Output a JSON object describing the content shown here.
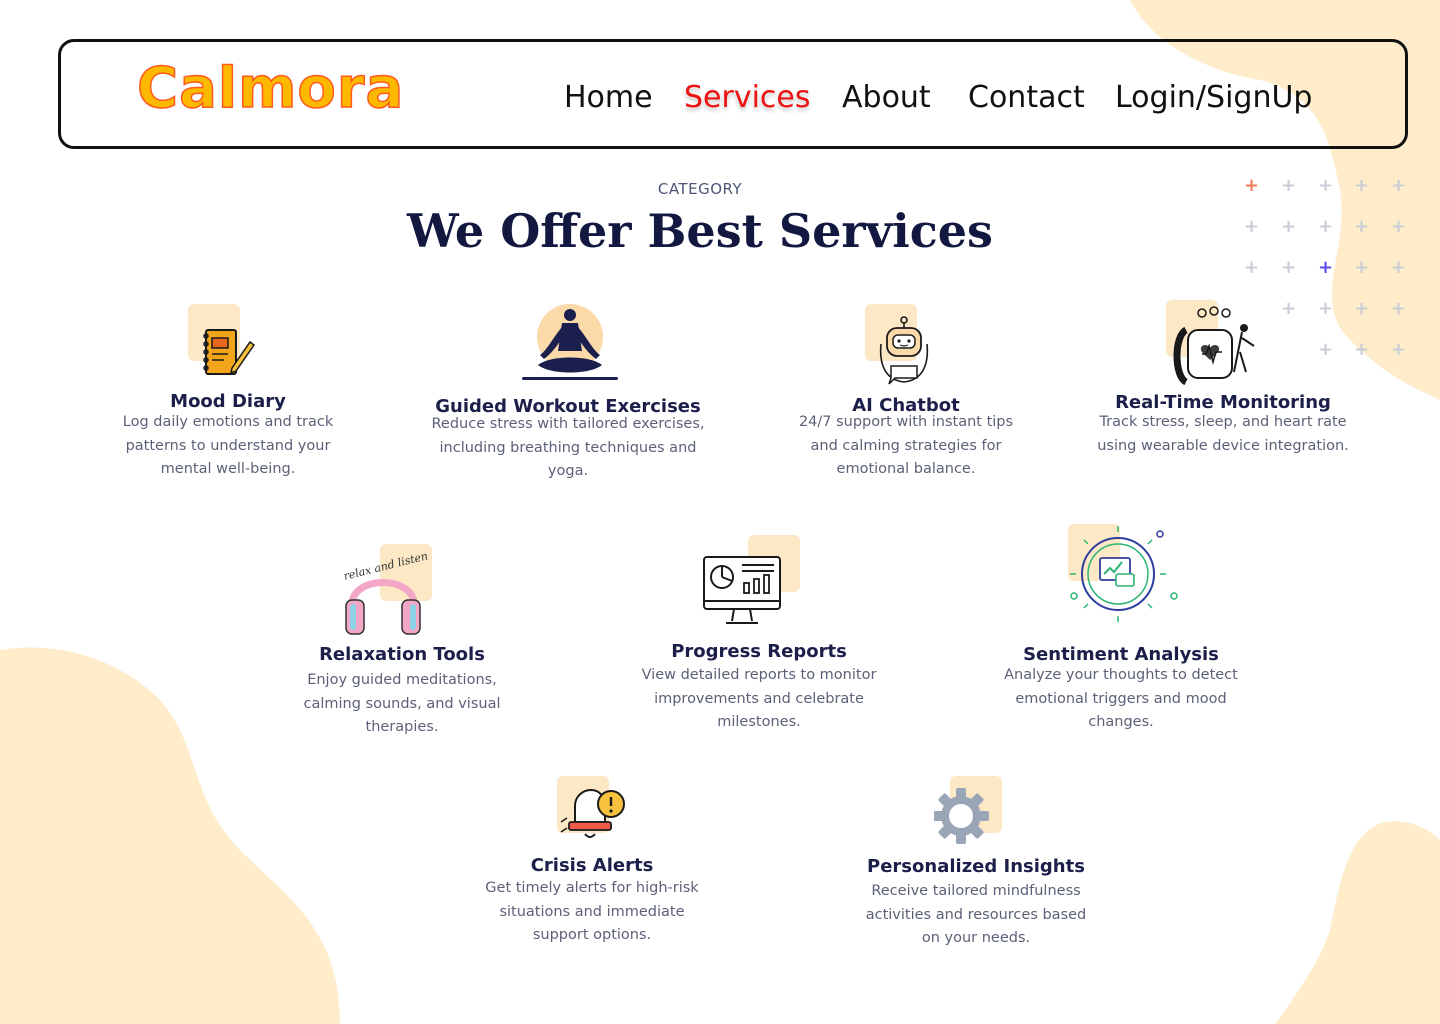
{
  "brand": {
    "logo_text": "Calmora"
  },
  "nav": {
    "items": [
      {
        "label": "Home",
        "active": false
      },
      {
        "label": "Services",
        "active": true
      },
      {
        "label": "About",
        "active": false
      },
      {
        "label": "Contact",
        "active": false
      },
      {
        "label": "Login/SignUp",
        "active": false
      }
    ]
  },
  "section": {
    "eyebrow": "CATEGORY",
    "title": "We Offer Best Services"
  },
  "services": [
    {
      "title": "Mood Diary",
      "description": "Log daily emotions and track patterns to understand your mental well-being.",
      "icon": "notebook-pencil-icon"
    },
    {
      "title": "Guided Workout Exercises",
      "description": "Reduce stress with tailored exercises, including breathing techniques and yoga.",
      "icon": "meditation-icon"
    },
    {
      "title": "AI Chatbot",
      "description": "24/7 support with instant tips and calming strategies for emotional balance.",
      "icon": "robot-chat-icon"
    },
    {
      "title": "Real-Time Monitoring",
      "description": "Track stress, sleep, and heart rate using wearable device integration.",
      "icon": "smartwatch-heart-icon"
    },
    {
      "title": "Relaxation Tools",
      "description": "Enjoy guided meditations, calming sounds, and visual therapies.",
      "icon": "headphones-icon",
      "icon_caption": "relax and listen"
    },
    {
      "title": "Progress Reports",
      "description": "View detailed reports to monitor improvements and celebrate milestones.",
      "icon": "monitor-chart-icon"
    },
    {
      "title": "Sentiment Analysis",
      "description": "Analyze your thoughts to detect emotional triggers and mood changes.",
      "icon": "sentiment-chart-icon"
    },
    {
      "title": "Crisis Alerts",
      "description": "Get timely alerts for high-risk situations and immediate support options.",
      "icon": "alert-bell-icon"
    },
    {
      "title": "Personalized Insights",
      "description": "Receive tailored mindfulness activities and resources based on your needs.",
      "icon": "gear-icon"
    }
  ],
  "colors": {
    "brand_yellow": "#ffb800",
    "brand_outline": "#ff5a1f",
    "nav_active": "#ee1111",
    "heading": "#131840",
    "icon_bg": "#fde8c6",
    "blob": "#feeccb"
  }
}
